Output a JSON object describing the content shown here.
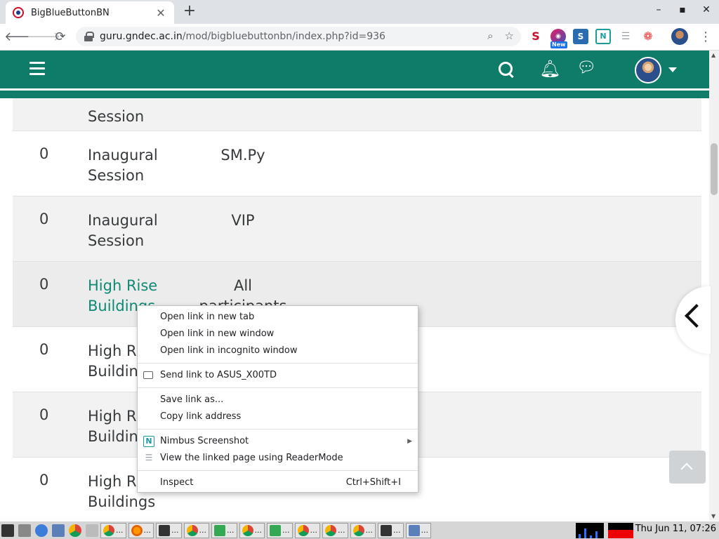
{
  "browser": {
    "tab_title": "BigBlueButtonBN",
    "tab_close": "✕",
    "new_tab": "+",
    "window_controls": [
      "–",
      "▪",
      "✕"
    ],
    "url_host": "guru.gndec.ac.in",
    "url_path": "/mod/bigbluebuttonbn/index.php?id=936",
    "extensions": [
      "S",
      "New",
      "S",
      "N"
    ]
  },
  "table": {
    "rows": [
      {
        "num": "",
        "name": "Session",
        "group": "",
        "link": false
      },
      {
        "num": "0",
        "name": "Inaugural Session",
        "group": "SM.Py",
        "link": false
      },
      {
        "num": "0",
        "name": "Inaugural Session",
        "group": "VIP",
        "link": false
      },
      {
        "num": "0",
        "name": "High Rise Buildings",
        "group": "All participants",
        "link": true
      },
      {
        "num": "0",
        "name": "High Rise Buildings",
        "group": "",
        "link": false
      },
      {
        "num": "0",
        "name": "High Rise Buildings",
        "group": "",
        "link": false
      },
      {
        "num": "0",
        "name": "High Rise Buildings",
        "group": "",
        "link": false
      }
    ]
  },
  "context_menu": {
    "open_new_tab": "Open link in new tab",
    "open_new_window": "Open link in new window",
    "open_incognito": "Open link in incognito window",
    "send_to_device": "Send link to ASUS_X00TD",
    "save_link": "Save link as...",
    "copy_address": "Copy link address",
    "nimbus": "Nimbus Screenshot",
    "reader_mode": "View the linked page using ReaderMode",
    "inspect": "Inspect",
    "inspect_shortcut": "Ctrl+Shift+I"
  },
  "taskbar": {
    "items": [
      {
        "icon": "chrome",
        "label": "..."
      },
      {
        "icon": "firefox",
        "label": "..."
      },
      {
        "icon": "terminal",
        "label": "..."
      },
      {
        "icon": "chrome",
        "label": "..."
      },
      {
        "icon": "sheet",
        "label": "..."
      },
      {
        "icon": "chrome",
        "label": "..."
      },
      {
        "icon": "sheet",
        "label": "..."
      },
      {
        "icon": "chrome",
        "label": "..."
      },
      {
        "icon": "chrome",
        "label": "..."
      },
      {
        "icon": "chrome",
        "label": "..."
      },
      {
        "icon": "terminal",
        "label": "..."
      },
      {
        "icon": "window",
        "label": "..."
      }
    ],
    "clock": "Thu Jun 11, 07:26"
  },
  "colors": {
    "navbar": "#0e7c69",
    "link": "#0e8a74"
  }
}
